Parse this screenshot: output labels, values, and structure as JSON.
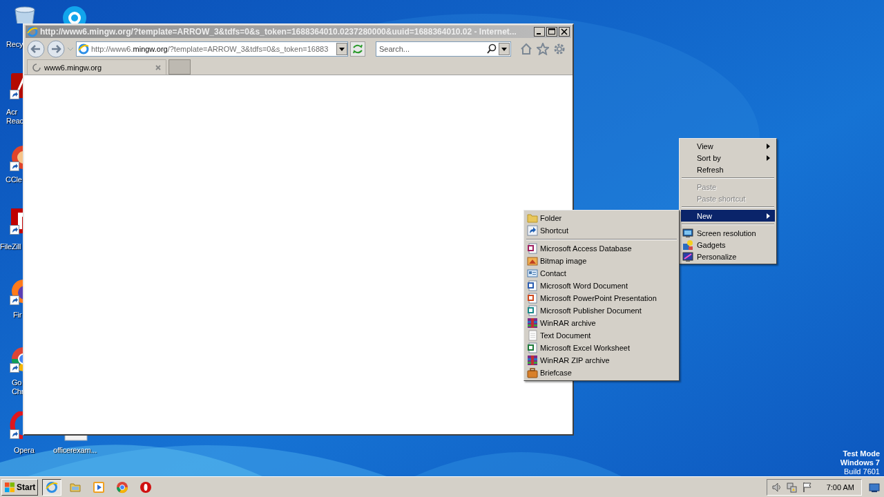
{
  "desktop": {
    "icons": [
      {
        "label_lines": [
          "Recy"
        ],
        "shortcut": false
      },
      {
        "shortcut": false
      },
      {
        "label_lines": [
          "Acr",
          "Reac"
        ],
        "shortcut": true
      },
      {
        "label_lines": [
          "CCle"
        ],
        "shortcut": true
      },
      {
        "label_lines": [
          "FileZill"
        ],
        "shortcut": true
      },
      {
        "label_lines": [
          "Fir"
        ],
        "shortcut": true
      },
      {
        "label_lines": [
          "Go",
          "Chr"
        ],
        "shortcut": true
      },
      {
        "label_lines": [
          "Opera"
        ],
        "shortcut": true
      },
      {
        "label_lines": [
          "officerexam..."
        ],
        "shortcut": false
      }
    ],
    "system_notice": [
      {
        "text": "Test Mode",
        "bold": true
      },
      {
        "text": "Windows 7",
        "bold": true
      },
      {
        "text": "Build 7601",
        "bold": false
      }
    ]
  },
  "window": {
    "title": "http://www6.mingw.org/?template=ARROW_3&tdfs=0&s_token=1688364010.0237280000&uuid=1688364010.02 - Internet...",
    "address": "http://www6.**mingw.org**/?template=ARROW_3&tdfs=0&s_token=16883",
    "search": {
      "placeholder": "Search..."
    },
    "tabs": [
      {
        "label": "www6.mingw.org",
        "selected": true
      }
    ]
  },
  "context_menu": {
    "items": [
      {
        "kind": "item",
        "label": "View",
        "submenu": true,
        "disabled": false,
        "selected": false
      },
      {
        "kind": "item",
        "label": "Sort by",
        "submenu": true,
        "disabled": false,
        "selected": false
      },
      {
        "kind": "item",
        "label": "Refresh",
        "submenu": false,
        "disabled": false,
        "selected": false
      },
      {
        "kind": "separator"
      },
      {
        "kind": "item",
        "label": "Paste",
        "submenu": false,
        "disabled": true,
        "selected": false
      },
      {
        "kind": "item",
        "label": "Paste shortcut",
        "submenu": false,
        "disabled": true,
        "selected": false
      },
      {
        "kind": "separator"
      },
      {
        "kind": "item",
        "label": "New",
        "submenu": true,
        "disabled": false,
        "selected": true
      },
      {
        "kind": "separator"
      },
      {
        "kind": "item",
        "label": "Screen resolution",
        "submenu": false,
        "disabled": false,
        "selected": false
      },
      {
        "kind": "item",
        "label": "Gadgets",
        "submenu": false,
        "disabled": false,
        "selected": false
      },
      {
        "kind": "item",
        "label": "Personalize",
        "submenu": false,
        "disabled": false,
        "selected": false
      }
    ]
  },
  "new_submenu": {
    "items": [
      {
        "kind": "item",
        "label": "Folder"
      },
      {
        "kind": "item",
        "label": "Shortcut"
      },
      {
        "kind": "separator"
      },
      {
        "kind": "item",
        "label": "Microsoft Access Database"
      },
      {
        "kind": "item",
        "label": "Bitmap image"
      },
      {
        "kind": "item",
        "label": "Contact"
      },
      {
        "kind": "item",
        "label": "Microsoft Word Document"
      },
      {
        "kind": "item",
        "label": "Microsoft PowerPoint Presentation"
      },
      {
        "kind": "item",
        "label": "Microsoft Publisher Document"
      },
      {
        "kind": "item",
        "label": "WinRAR archive"
      },
      {
        "kind": "item",
        "label": "Text Document"
      },
      {
        "kind": "item",
        "label": "Microsoft Excel Worksheet"
      },
      {
        "kind": "item",
        "label": "WinRAR ZIP archive"
      },
      {
        "kind": "item",
        "label": "Briefcase"
      }
    ]
  },
  "taskbar": {
    "start": "Start",
    "apps": [
      {
        "selected": true
      },
      {
        "selected": false
      },
      {
        "selected": false
      },
      {
        "selected": false
      },
      {
        "selected": false
      }
    ],
    "clock": "7:00 AM"
  }
}
